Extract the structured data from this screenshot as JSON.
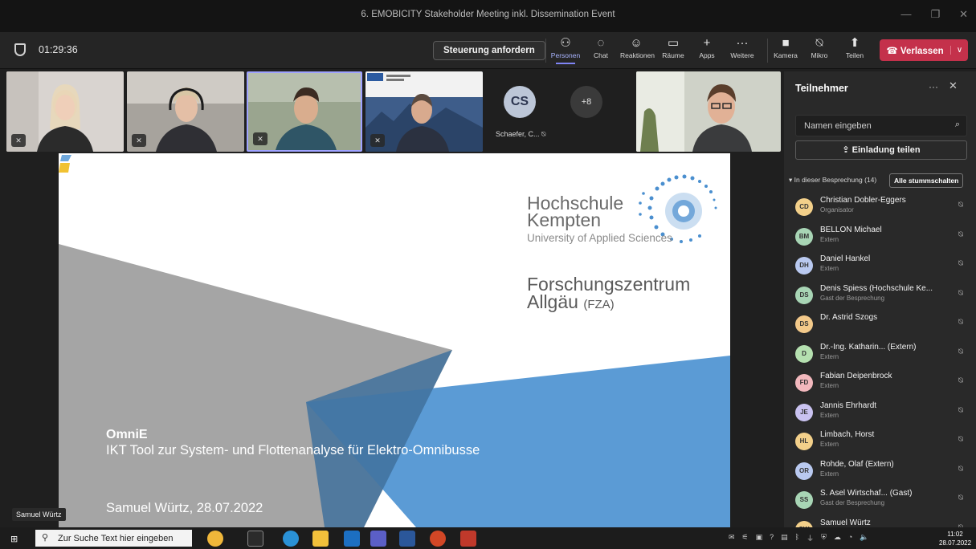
{
  "window": {
    "title": "6. EMOBICITY Stakeholder Meeting inkl. Dissemination Event"
  },
  "toolbar": {
    "timer": "01:29:36",
    "request_control": "Steuerung anfordern",
    "tools": [
      {
        "label": "Personen",
        "icon": "people-icon"
      },
      {
        "label": "Chat",
        "icon": "chat-icon"
      },
      {
        "label": "Reaktionen",
        "icon": "reactions-icon"
      },
      {
        "label": "Räume",
        "icon": "rooms-icon"
      },
      {
        "label": "Apps",
        "icon": "plus-icon"
      },
      {
        "label": "Weitere",
        "icon": "more-icon"
      }
    ],
    "media": [
      {
        "label": "Kamera",
        "icon": "camera-icon"
      },
      {
        "label": "Mikro",
        "icon": "mic-off-icon"
      },
      {
        "label": "Teilen",
        "icon": "share-icon"
      }
    ],
    "leave": "Verlassen"
  },
  "videos": {
    "avatar_initials": "CS",
    "avatar_name": "Schaefer, C...",
    "overflow": "+8"
  },
  "slide": {
    "hk_line1": "Hochschule",
    "hk_line2": "Kempten",
    "hk_line3": "University of Applied Sciences",
    "fza_line1": "Forschungszentrum",
    "fza_line2": "Allgäu",
    "fza_abbr": "(FZA)",
    "project": "OmniE",
    "subtitle": "IKT Tool zur System- und Flottenanalyse für Elektro-Omnibusse",
    "author": "Samuel Würtz, 28.07.2022",
    "colors": {
      "blue": "#5b9bd5",
      "grey": "#a5a5a5"
    }
  },
  "presenter_tag": "Samuel Würtz",
  "panel": {
    "title": "Teilnehmer",
    "search_placeholder": "Namen eingeben",
    "invite": "Einladung teilen",
    "section": "In dieser Besprechung (14)",
    "mute_all": "Alle stummschalten",
    "participants": [
      {
        "initials": "CD",
        "name": "Christian Dobler-Eggers",
        "role": "Organisator",
        "color": "#f3d08a"
      },
      {
        "initials": "BM",
        "name": "BELLON Michael",
        "role": "Extern",
        "color": "#a8d5b5"
      },
      {
        "initials": "DH",
        "name": "Daniel Hankel",
        "role": "Extern",
        "color": "#b9c9f0"
      },
      {
        "initials": "DS",
        "name": "Denis Spiess (Hochschule Ke...",
        "role": "Gast der Besprechung",
        "color": "#a8d5b5"
      },
      {
        "initials": "DS",
        "name": "Dr. Astrid Szogs",
        "role": "",
        "color": "#f3c98a"
      },
      {
        "initials": "D",
        "name": "Dr.-Ing. Katharin... (Extern)",
        "role": "Extern",
        "color": "#b5e0b0"
      },
      {
        "initials": "FD",
        "name": "Fabian Deipenbrock",
        "role": "Extern",
        "color": "#f2b8bd"
      },
      {
        "initials": "JE",
        "name": "Jannis Ehrhardt",
        "role": "Extern",
        "color": "#c9c2f0"
      },
      {
        "initials": "HL",
        "name": "Limbach, Horst",
        "role": "Extern",
        "color": "#f3d08a"
      },
      {
        "initials": "OR",
        "name": "Rohde, Olaf (Extern)",
        "role": "Extern",
        "color": "#b9c9f0"
      },
      {
        "initials": "SS",
        "name": "S. Asel Wirtschaf... (Gast)",
        "role": "Gast der Besprechung",
        "color": "#a8d5b5"
      },
      {
        "initials": "SW",
        "name": "Samuel Würtz",
        "role": "",
        "color": "#f3d08a"
      }
    ]
  },
  "taskbar": {
    "search_placeholder": "Zur Suche Text hier eingeben",
    "time": "11:02",
    "date": "28.07.2022"
  }
}
